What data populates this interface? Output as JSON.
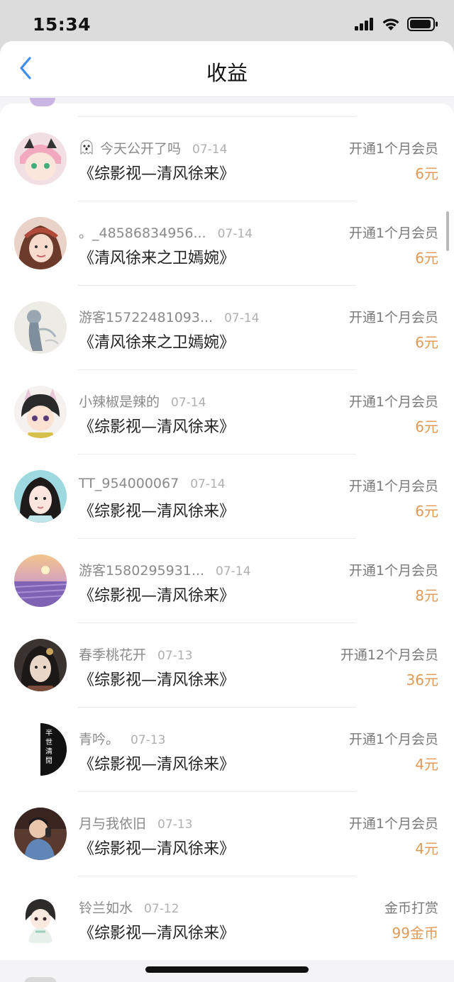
{
  "status_bar": {
    "time": "15:34"
  },
  "nav": {
    "title": "收益"
  },
  "records": [
    {
      "user": "今天公开了吗",
      "date": "07-14",
      "book": "《综影视—清风徐来》",
      "type": "开通1个月会员",
      "amount": "6元",
      "ghost": true
    },
    {
      "user": "。_48586834956...",
      "date": "07-14",
      "book": "《清风徐来之卫嫣婉》",
      "type": "开通1个月会员",
      "amount": "6元"
    },
    {
      "user": "游客15722481093...",
      "date": "07-14",
      "book": "《清风徐来之卫嫣婉》",
      "type": "开通1个月会员",
      "amount": "6元"
    },
    {
      "user": "小辣椒是辣的",
      "date": "07-14",
      "book": "《综影视—清风徐来》",
      "type": "开通1个月会员",
      "amount": "6元"
    },
    {
      "user": "TT_954000067",
      "date": "07-14",
      "book": "《综影视—清风徐来》",
      "type": "开通1个月会员",
      "amount": "6元"
    },
    {
      "user": "游客1580295931...",
      "date": "07-14",
      "book": "《综影视—清风徐来》",
      "type": "开通1个月会员",
      "amount": "8元"
    },
    {
      "user": "春季桃花开",
      "date": "07-13",
      "book": "《综影视—清风徐来》",
      "type": "开通12个月会员",
      "amount": "36元"
    },
    {
      "user": "青吟。",
      "date": "07-13",
      "book": "《综影视—清风徐来》",
      "type": "开通1个月会员",
      "amount": "4元",
      "avatar_text": "半世清閒"
    },
    {
      "user": "月与我依旧",
      "date": "07-13",
      "book": "《综影视—清风徐来》",
      "type": "开通1个月会员",
      "amount": "4元"
    },
    {
      "user": "铃兰如水",
      "date": "07-12",
      "book": "《综影视—清风徐来》",
      "type": "金币打赏",
      "amount": "99金币"
    }
  ],
  "colors": {
    "accent_back": "#3d8ff2",
    "amount": "#e09a56",
    "status_bar_bg": "#dcdcdc"
  },
  "icons": {
    "back": "chevron-left-icon",
    "signal": "signal-icon",
    "wifi": "wifi-icon",
    "battery": "battery-icon",
    "ghost": "ghost-icon"
  }
}
